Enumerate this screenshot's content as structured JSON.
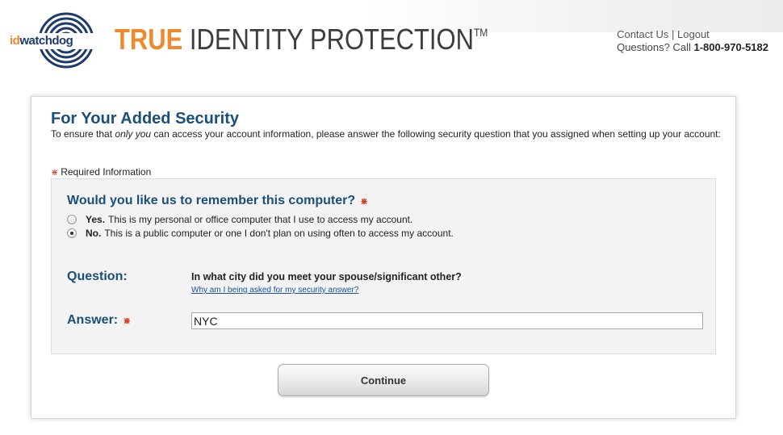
{
  "header": {
    "logo": {
      "id_text": "id",
      "rest_text": "watchdog"
    },
    "brand": {
      "true_text": "TRUE",
      "rest_text": " IDENTITY PROTECTION",
      "tm": "TM"
    },
    "contact_link": "Contact Us",
    "separator": "|",
    "logout_link": "Logout",
    "questions_label": "Questions? Call ",
    "phone": "1-800-970-5182"
  },
  "panel": {
    "title": "For Your Added Security",
    "intro_before": "To ensure that ",
    "intro_emphasis": "only you",
    "intro_after": " can access your account information, please answer the following security question that you assigned when setting up your account:",
    "required_star": "⋇",
    "required_note": "Required Information"
  },
  "remember": {
    "question": "Would you like us to remember this computer?",
    "required_star": "⋇",
    "options": [
      {
        "bold": "Yes.",
        "text": "This is my personal or office computer that I use to access my account.",
        "selected": false
      },
      {
        "bold": "No.",
        "text": "This is a public computer or one I don't plan on using often to access my account.",
        "selected": true
      }
    ]
  },
  "security": {
    "question_label": "Question:",
    "question_text": "In what city did you meet your spouse/significant other?",
    "why_link": "Why am I being asked for my security answer?",
    "answer_label": "Answer:",
    "answer_star": "⋇",
    "answer_value": "NYC"
  },
  "actions": {
    "continue_label": "Continue"
  },
  "colors": {
    "brand_orange": "#f0892c",
    "heading_blue": "#1a4f7a",
    "required_red": "#d9381e"
  }
}
